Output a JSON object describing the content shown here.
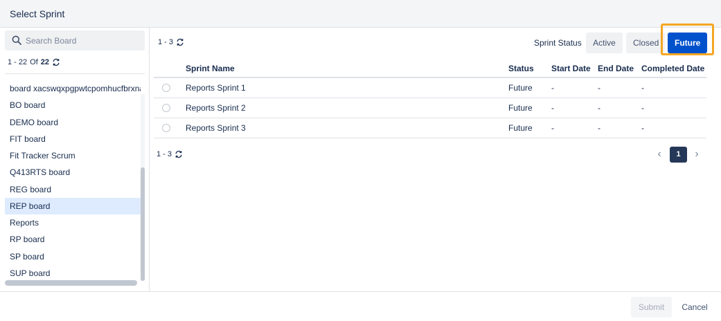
{
  "dialog": {
    "title": "Select Sprint"
  },
  "sidebar": {
    "search_placeholder": "Search Board",
    "count": {
      "range": "1 - 22",
      "of_label": "Of",
      "total": "22"
    },
    "boards": [
      {
        "label": "board xacswqxpgpwtcpomhucfbrxna"
      },
      {
        "label": "BO board"
      },
      {
        "label": "DEMO board"
      },
      {
        "label": "FIT board"
      },
      {
        "label": "Fit Tracker Scrum"
      },
      {
        "label": "Q413RTS board"
      },
      {
        "label": "REG board"
      },
      {
        "label": "REP board"
      },
      {
        "label": "Reports"
      },
      {
        "label": "RP board"
      },
      {
        "label": "SP board"
      },
      {
        "label": "SUP board"
      }
    ],
    "selected_board": "REP board"
  },
  "main": {
    "count_top": "1 - 3",
    "count_bottom": "1 - 3",
    "status_label": "Sprint Status",
    "status_buttons": {
      "active": "Active",
      "closed": "Closed",
      "future": "Future"
    },
    "selected_status": "Future",
    "columns": {
      "name": "Sprint Name",
      "status": "Status",
      "start": "Start Date",
      "end": "End Date",
      "completed": "Completed Date"
    },
    "rows": [
      {
        "name": "Reports Sprint 1",
        "status": "Future",
        "start": "-",
        "end": "-",
        "completed": "-"
      },
      {
        "name": "Reports Sprint 2",
        "status": "Future",
        "start": "-",
        "end": "-",
        "completed": "-"
      },
      {
        "name": "Reports Sprint 3",
        "status": "Future",
        "start": "-",
        "end": "-",
        "completed": "-"
      }
    ],
    "pagination": {
      "current_page": "1"
    }
  },
  "footer": {
    "submit_label": "Submit",
    "cancel_label": "Cancel"
  },
  "colors": {
    "accent": "#0052cc",
    "highlight": "#f5a623",
    "selected_row": "#deebff",
    "page_active": "#253858"
  },
  "icons": {
    "search": "search-icon",
    "refresh": "refresh-icon",
    "prev": "chevron-left-icon",
    "next": "chevron-right-icon"
  }
}
